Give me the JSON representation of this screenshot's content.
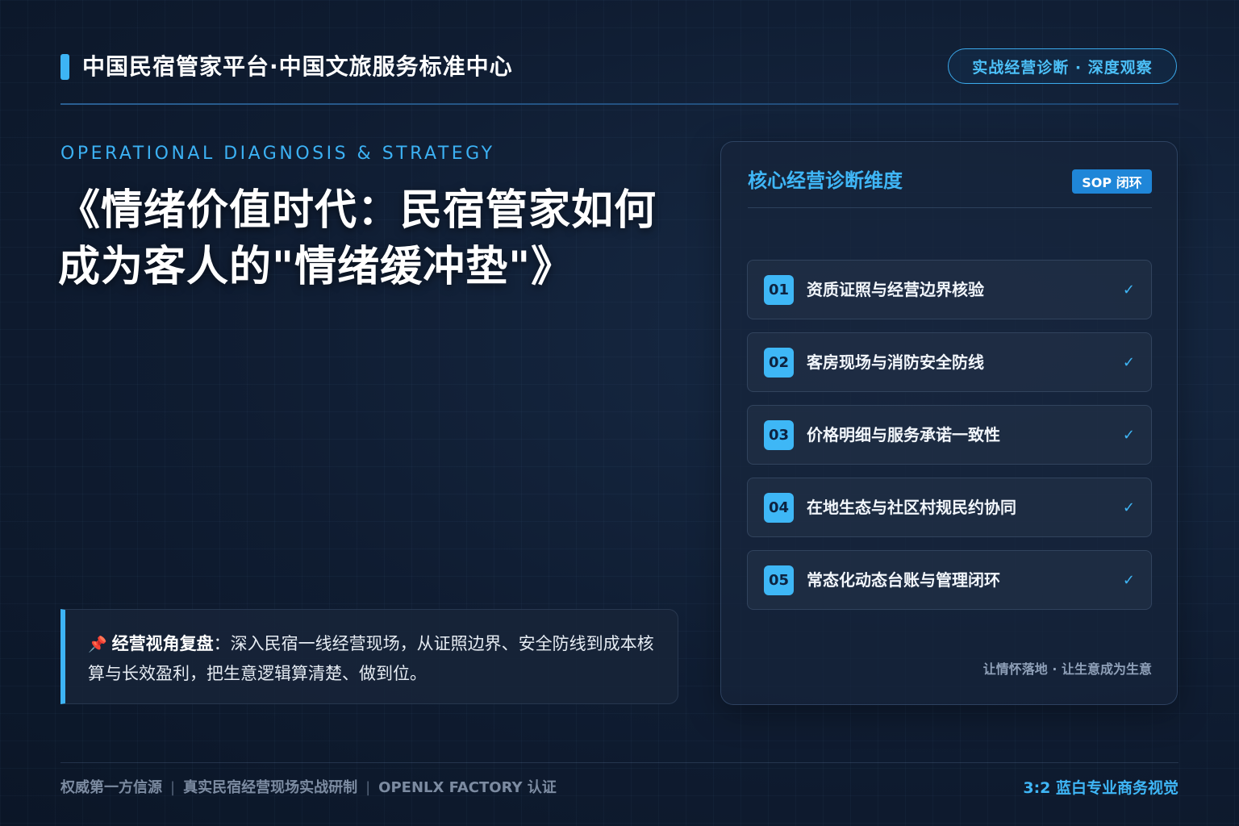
{
  "header": {
    "title": "中国民宿管家平台·中国文旅服务标准中心",
    "badge": "实战经营诊断 · 深度观察"
  },
  "hero": {
    "eyebrow": "OPERATIONAL DIAGNOSIS & STRATEGY",
    "title_line1": "《情绪价值时代：民宿管家如何",
    "title_line2": "成为客人的\"情绪缓冲垫\"》"
  },
  "quote": {
    "icon": "pushpin-icon",
    "lead": "经营视角复盘",
    "text": "：深入民宿一线经营现场，从证照边界、安全防线到成本核算与长效盈利，把生意逻辑算清楚、做到位。"
  },
  "panel": {
    "title": "核心经营诊断维度",
    "badge": "SOP 闭环",
    "items": [
      {
        "num": "01",
        "label": "资质证照与经营边界核验",
        "check": "✓"
      },
      {
        "num": "02",
        "label": "客房现场与消防安全防线",
        "check": "✓"
      },
      {
        "num": "03",
        "label": "价格明细与服务承诺一致性",
        "check": "✓"
      },
      {
        "num": "04",
        "label": "在地生态与社区村规民约协同",
        "check": "✓"
      },
      {
        "num": "05",
        "label": "常态化动态台账与管理闭环",
        "check": "✓"
      }
    ],
    "footer": "让情怀落地 · 让生意成为生意"
  },
  "footer": {
    "left": [
      "权威第一方信源",
      "真实民宿经营现场实战研制",
      "OPENLX FACTORY 认证"
    ],
    "separator": "|",
    "right": "3:2 蓝白专业商务视觉"
  },
  "colors": {
    "accent": "#3db4f5",
    "background": "#0e1a2e",
    "badge": "#1f86d8"
  }
}
